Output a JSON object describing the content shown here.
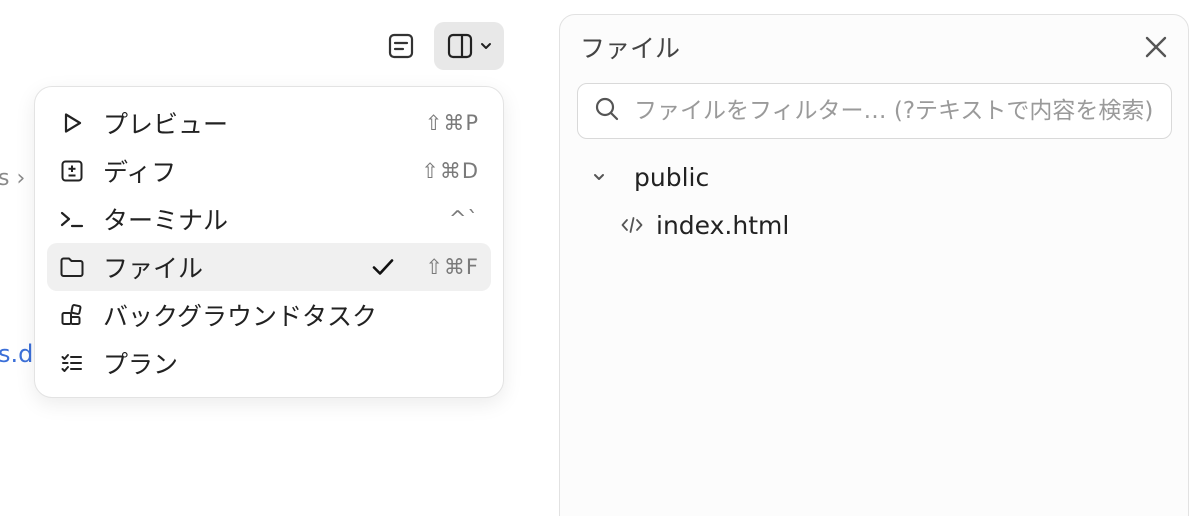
{
  "background": {
    "breadcrumb_fragment": "s ›",
    "link_fragment": "s.d"
  },
  "toolbar": {
    "notes_icon": "notes-icon",
    "panel_icon": "sidebar-panel-icon",
    "panel_chevron_icon": "chevron-down-icon"
  },
  "menu": {
    "items": [
      {
        "label": "プレビュー",
        "shortcut": "⇧⌘P",
        "icon": "play-icon",
        "checked": false
      },
      {
        "label": "ディフ",
        "shortcut": "⇧⌘D",
        "icon": "diff-icon",
        "checked": false
      },
      {
        "label": "ターミナル",
        "shortcut": "^`",
        "icon": "terminal-icon",
        "checked": false
      },
      {
        "label": "ファイル",
        "shortcut": "⇧⌘F",
        "icon": "folder-icon",
        "checked": true
      },
      {
        "label": "バックグラウンドタスク",
        "shortcut": "",
        "icon": "background-tasks-icon",
        "checked": false
      },
      {
        "label": "プラン",
        "shortcut": "",
        "icon": "checklist-icon",
        "checked": false
      }
    ]
  },
  "files_panel": {
    "title": "ファイル",
    "search_placeholder": "ファイルをフィルター… (?テキストで内容を検索)",
    "tree": {
      "folder": "public",
      "file": "index.html"
    }
  },
  "colors": {
    "active_item_bg": "#f0f0f0",
    "toolbar_active_bg": "#e8e8e8",
    "link": "#3b6fd8"
  }
}
